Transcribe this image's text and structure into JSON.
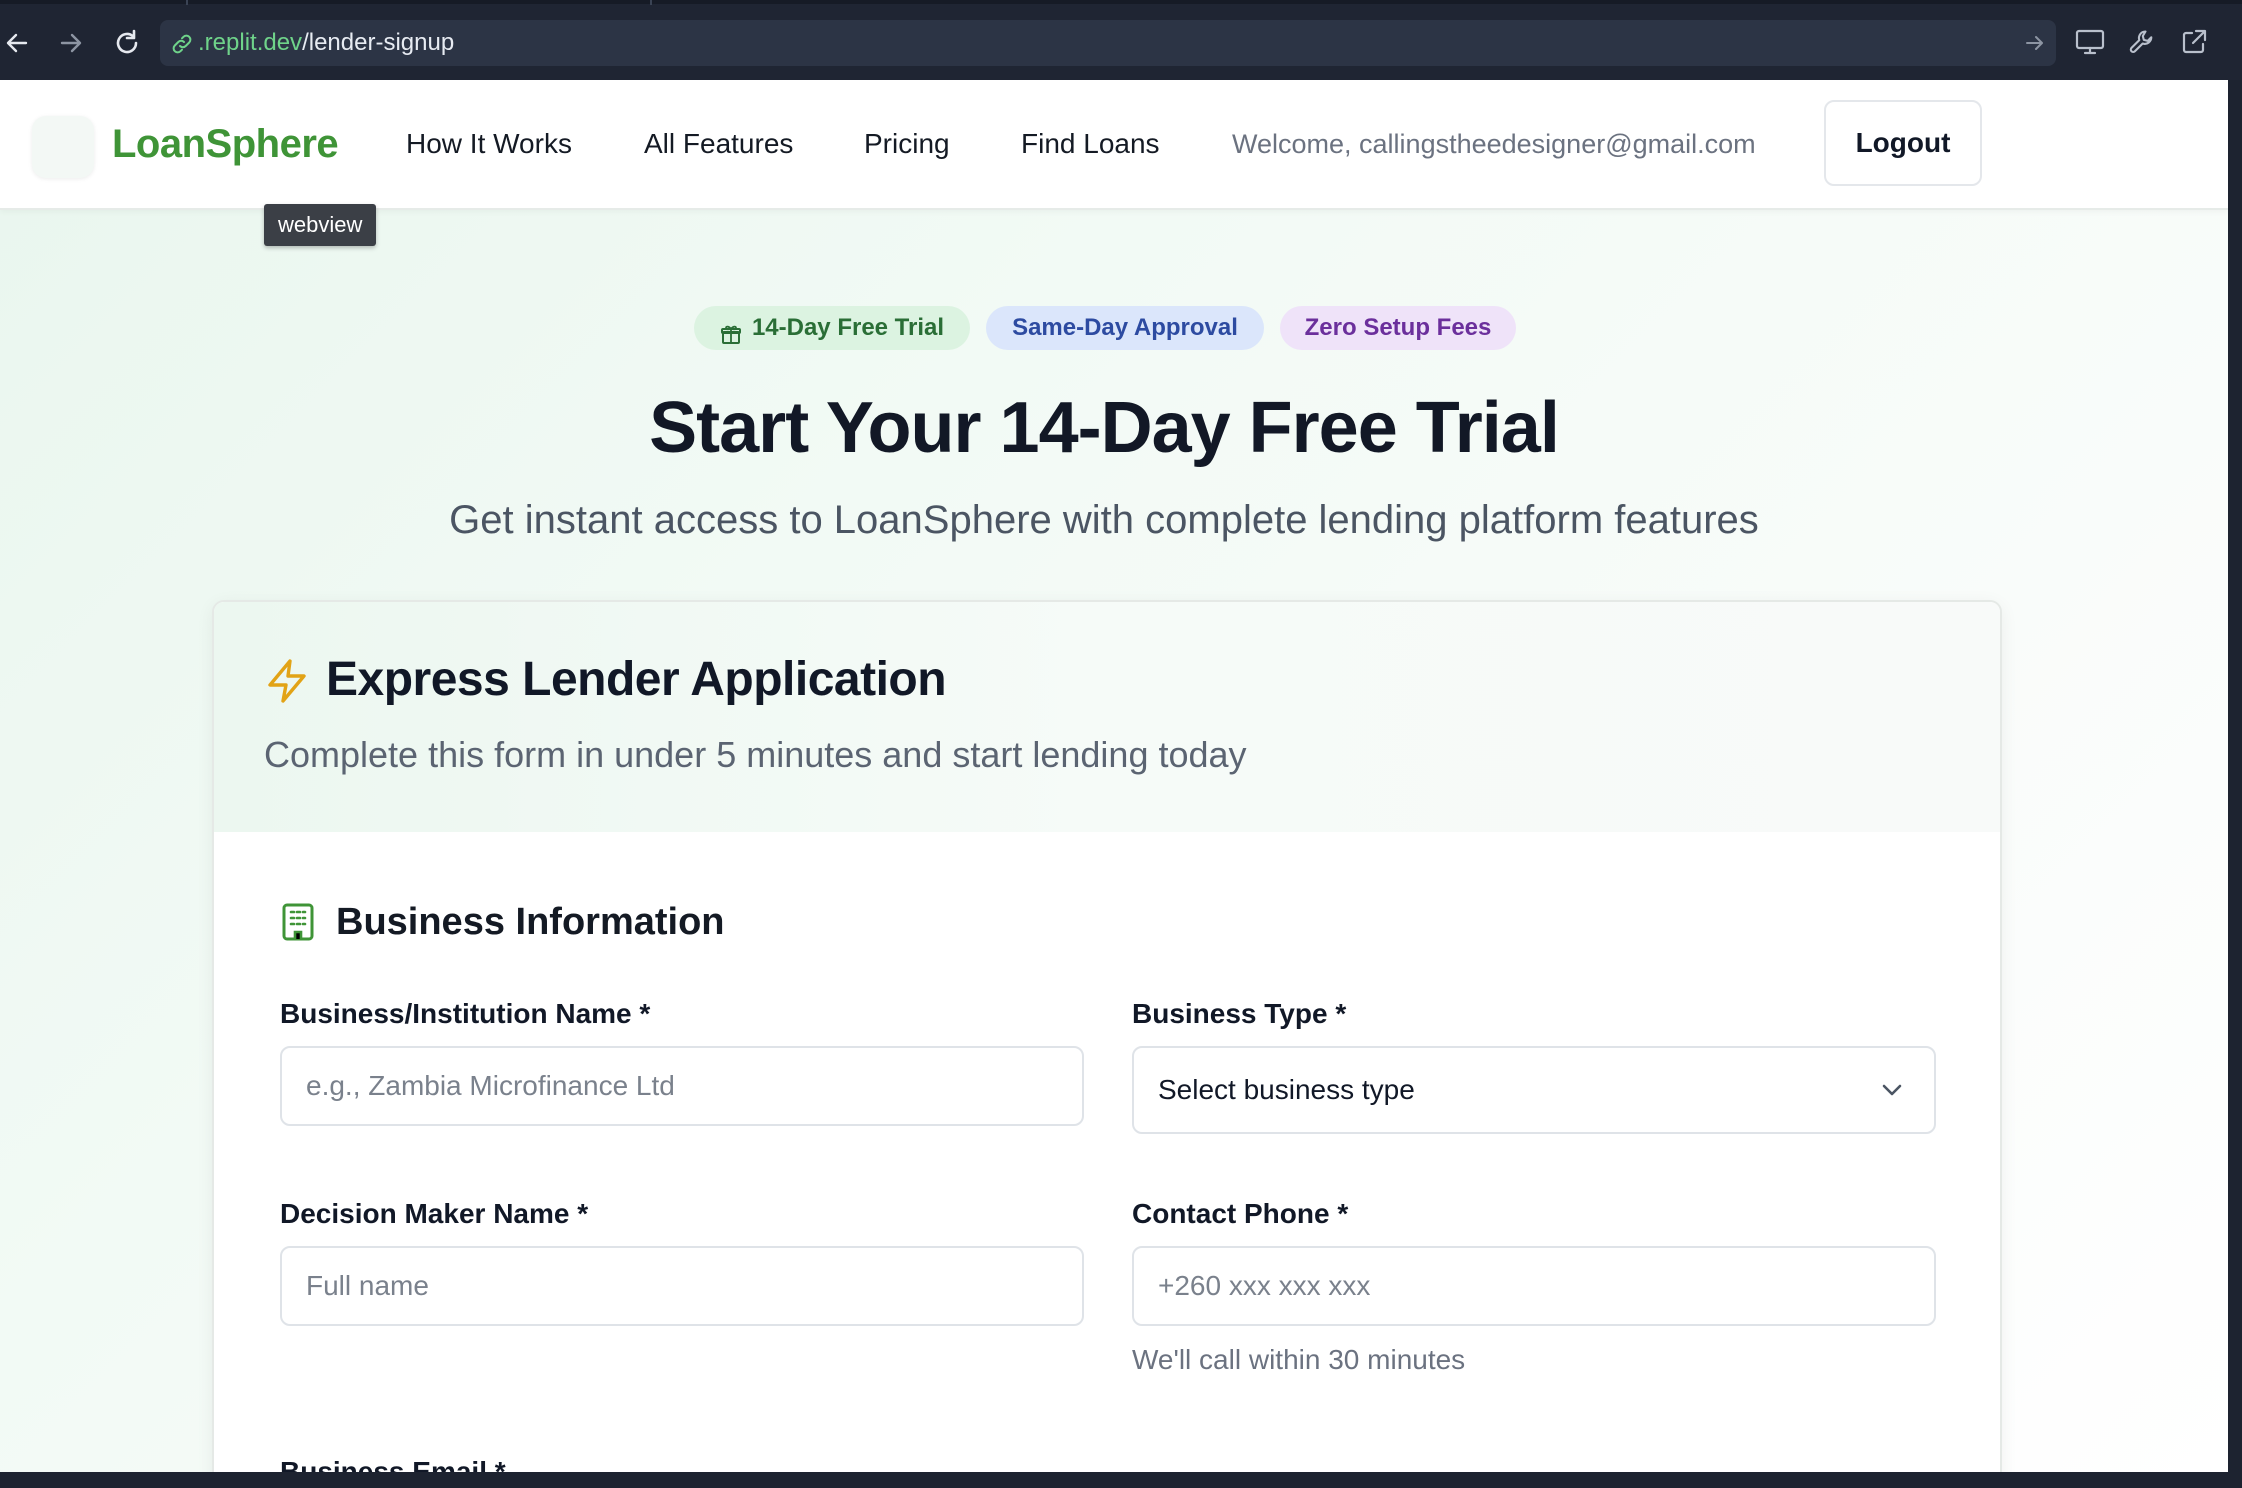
{
  "browser": {
    "url_domain": ".replit.dev",
    "url_path": "/lender-signup"
  },
  "header": {
    "logo_text": "LoanSphere",
    "nav": [
      {
        "label": "How It Works"
      },
      {
        "label": "All Features"
      },
      {
        "label": "Pricing"
      },
      {
        "label": "Find Loans"
      }
    ],
    "welcome_text": "Welcome, callingstheedesigner@gmail.com",
    "logout_label": "Logout"
  },
  "tooltip": "webview",
  "hero": {
    "badges": [
      {
        "label": "14-Day Free Trial",
        "icon": "gift-icon"
      },
      {
        "label": "Same-Day Approval"
      },
      {
        "label": "Zero Setup Fees"
      }
    ],
    "title": "Start Your 14-Day Free Trial",
    "subtitle": "Get instant access to LoanSphere with complete lending platform features"
  },
  "form": {
    "title": "Express Lender Application",
    "title_icon": "lightning-icon",
    "subtitle": "Complete this form in under 5 minutes and start lending today",
    "section_title": "Business Information",
    "section_icon": "building-icon",
    "fields": {
      "business_name": {
        "label": "Business/Institution Name *",
        "placeholder": "e.g., Zambia Microfinance Ltd"
      },
      "business_type": {
        "label": "Business Type *",
        "value": "Select business type"
      },
      "decision_maker": {
        "label": "Decision Maker Name *",
        "placeholder": "Full name"
      },
      "contact_phone": {
        "label": "Contact Phone *",
        "placeholder": "+260 xxx xxx xxx",
        "hint": "We'll call within 30 minutes"
      },
      "business_email": {
        "label": "Business Email *"
      }
    }
  },
  "colors": {
    "brand_green": "#3f9437",
    "accent_yellow": "#e2a316",
    "badge_green_bg": "#dcf3e1",
    "badge_blue_bg": "#dbe6fb",
    "badge_purple_bg": "#efe3f9"
  }
}
